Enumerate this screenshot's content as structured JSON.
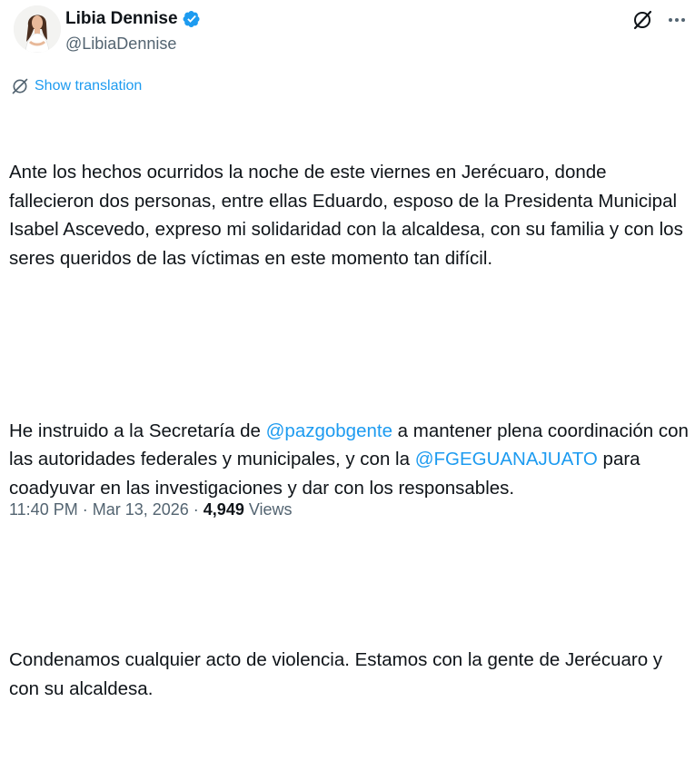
{
  "author": {
    "display_name": "Libia Dennise",
    "handle": "@LibiaDennise",
    "verified": true
  },
  "actions": {
    "grok_icon": "grok-icon",
    "more_icon": "more-icon"
  },
  "translation": {
    "label": "Show translation",
    "icon": "translate-icon"
  },
  "tweet": {
    "p1": "Ante los hechos ocurridos la noche de este viernes en Jerécuaro, donde fallecieron dos personas, entre ellas Eduardo, esposo de la Presidenta Municipal Isabel Ascevedo, expreso mi solidaridad con la alcaldesa, con su familia y con los seres queridos de las víctimas en este momento tan difícil.",
    "p2_part1": "He instruido a la Secretaría de ",
    "mention1": "@pazgobgente",
    "p2_part2": " a mantener plena coordinación con las autoridades federales y municipales, y con la ",
    "mention2": "@FGEGUANAJUATO",
    "p2_part3": " para coadyuvar en las investigaciones y dar con los responsables.",
    "p3": "Condenamos cualquier acto de violencia. Estamos con la gente de Jerécuaro y con su alcaldesa."
  },
  "meta": {
    "time": "11:40 PM",
    "separator": "·",
    "date": "Mar 13, 2026",
    "views_count": "4,949",
    "views_label": "Views"
  },
  "colors": {
    "accent": "#1d9bf0",
    "text": "#0f1419",
    "secondary": "#536471"
  }
}
